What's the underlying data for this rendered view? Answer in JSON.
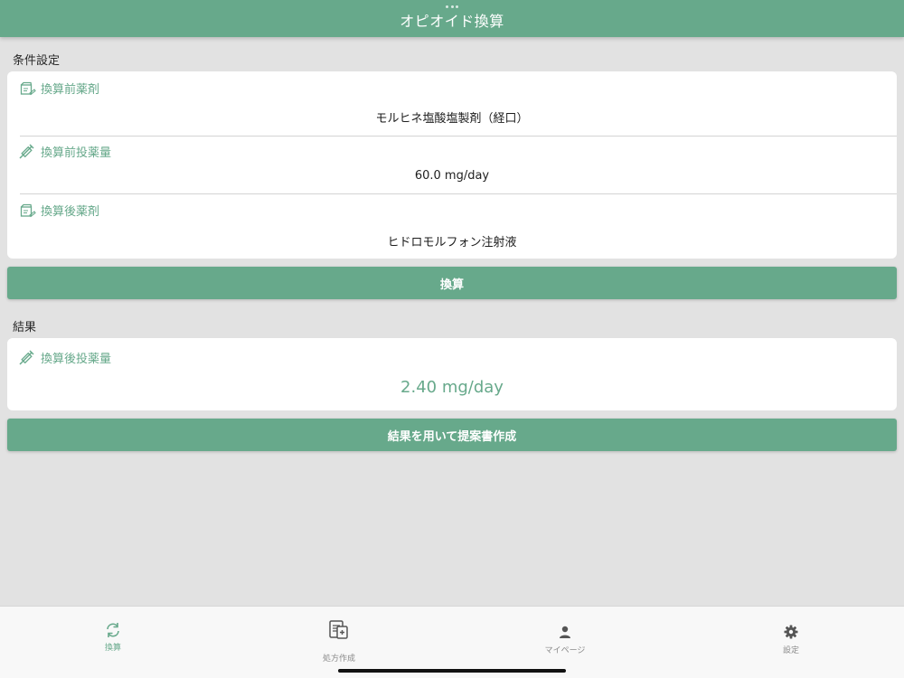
{
  "header": {
    "title": "オピオイド換算"
  },
  "conditions": {
    "section_label": "条件設定",
    "before_drug": {
      "label": "換算前薬剤",
      "value": "モルヒネ塩酸塩製剤（経口）"
    },
    "before_dose": {
      "label": "換算前投薬量",
      "value": "60.0 mg/day"
    },
    "after_drug": {
      "label": "換算後薬剤",
      "value": "ヒドロモルフォン注射液"
    }
  },
  "convert_button": "換算",
  "result": {
    "section_label": "結果",
    "after_dose": {
      "label": "換算後投薬量",
      "value": "2.40 mg/day"
    }
  },
  "proposal_button": "結果を用いて提案書作成",
  "tabs": [
    {
      "label": "換算",
      "icon": "refresh-icon",
      "active": true
    },
    {
      "label": "処方作成",
      "icon": "prescription-icon",
      "active": false
    },
    {
      "label": "マイページ",
      "icon": "person-icon",
      "active": false
    },
    {
      "label": "設定",
      "icon": "gear-icon",
      "active": false
    }
  ],
  "colors": {
    "accent": "#67a98b",
    "background": "#e2e2e2"
  }
}
